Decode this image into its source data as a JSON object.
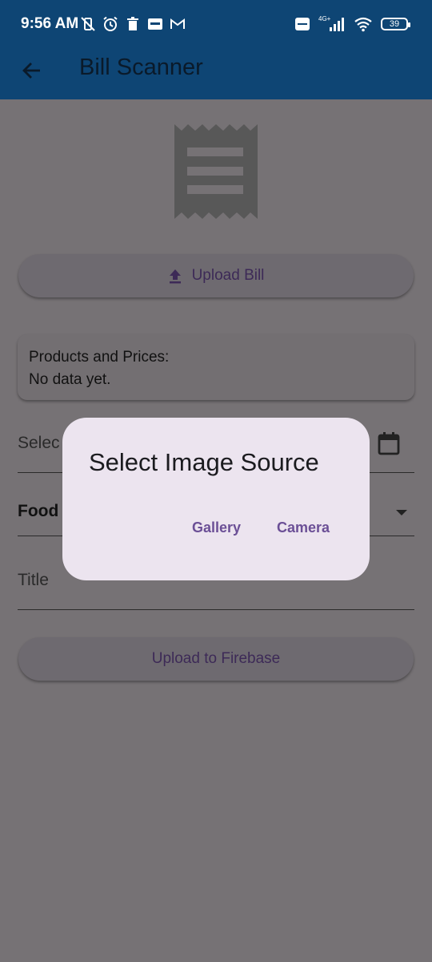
{
  "status_bar": {
    "time": "9:56 AM",
    "battery": "39",
    "network": "4G+"
  },
  "app_bar": {
    "title": "Bill Scanner"
  },
  "upload_bill": {
    "label": "Upload Bill"
  },
  "info_card": {
    "line1": "Products and Prices:",
    "line2": "No data yet."
  },
  "date_field": {
    "label": "Selec"
  },
  "category_field": {
    "value": "Food"
  },
  "title_field": {
    "label": "Title"
  },
  "upload_firebase": {
    "label": "Upload to Firebase"
  },
  "dialog": {
    "title": "Select Image Source",
    "gallery_label": "Gallery",
    "camera_label": "Camera"
  },
  "colors": {
    "app_bar": "#0e4574",
    "scrim_background": "#767275",
    "dialog_background": "#ece4ef",
    "accent": "#6b4f96"
  }
}
